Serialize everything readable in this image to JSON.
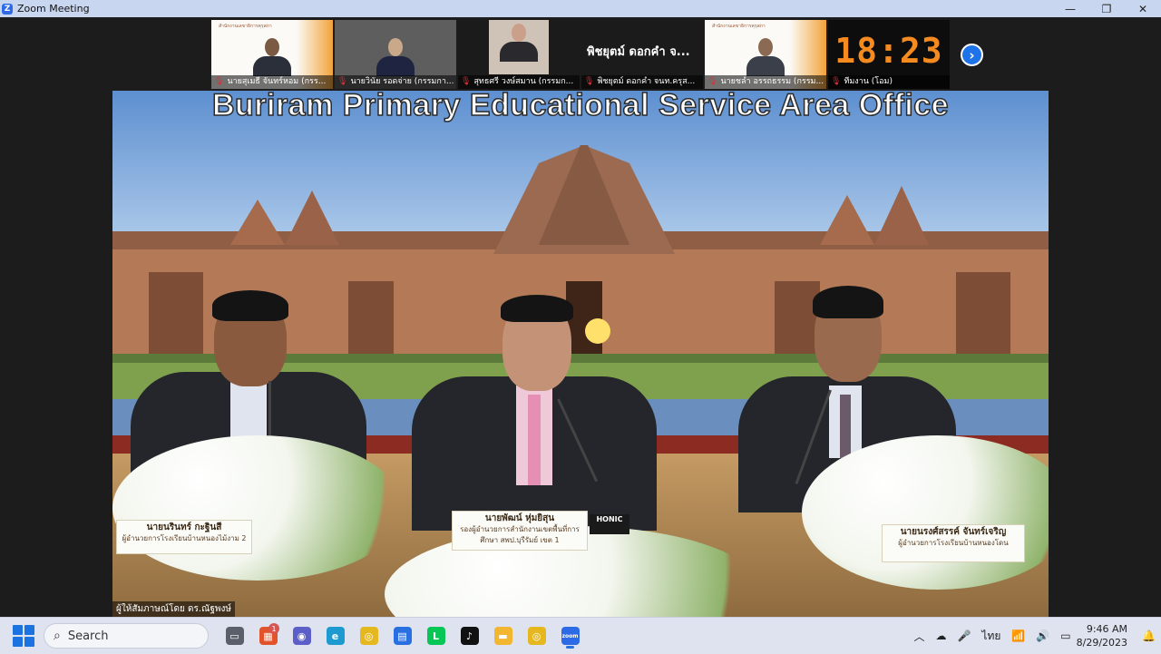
{
  "window": {
    "title": "Zoom Meeting",
    "controls": [
      "—",
      "❐",
      "✕"
    ]
  },
  "participants": [
    {
      "label": "นายสุเมธี จันทร์หอม (กรร...",
      "type": "video-logo",
      "logo_text": "สำนักงานเลขาธิการคุรุสภา"
    },
    {
      "label": "นายวินัย รอดจ่าย (กรรมกา...",
      "type": "video-gray"
    },
    {
      "label": "สุทธศรี วงษ์สมาน (กรรมก...",
      "type": "video-dark"
    },
    {
      "label": "พิชยุตม์ ดอกคำ จนท.ครุส...",
      "type": "name-only",
      "display_name": "พิชยุตม์ ดอกคำ จ..."
    },
    {
      "label": "นายชลำ อรรถธรรม (กรรม...",
      "type": "video-logo",
      "logo_text": "สำนักงานเลขาธิการคุรุสภา"
    },
    {
      "label": "ทีมงาน (โอม)",
      "type": "clock",
      "clock_text": "18:23"
    }
  ],
  "next_button": "›",
  "main_video": {
    "banner": "Buriram Primary Educational Service Area Office",
    "nameplates": [
      {
        "name": "นายนรินทร์ กะฐินสี",
        "role": "ผู้อำนวยการโรงเรียนบ้านหนองไม้งาม 2"
      },
      {
        "name": "นายพัฒน์ หุ่มยิสุน",
        "role": "รองผู้อำนวยการสำนักงานเขตพื้นที่การศึกษา สพป.บุรีรัมย์ เขต 1"
      },
      {
        "name": "นายนรงศ์สรรค์ จันทร์เจริญ",
        "role": "ผู้อำนวยการโรงเรียนบ้านหนองโดน"
      }
    ],
    "mic_brand": "HONIC",
    "caption": "ผู้ให้สัมภาษณ์โดย ดร.ณัฐพงษ์"
  },
  "taskbar": {
    "search_label": "Search",
    "apps": [
      {
        "name": "task-view",
        "color": "#5b5f6b",
        "text": "▭"
      },
      {
        "name": "microsoft-365",
        "color": "#e0532b",
        "text": "▦",
        "badge": "1"
      },
      {
        "name": "teams-meet",
        "color": "#5b5fc7",
        "text": "◉"
      },
      {
        "name": "edge",
        "color": "#1d9bd1",
        "text": "e"
      },
      {
        "name": "chrome",
        "color": "#e5b820",
        "text": "◎"
      },
      {
        "name": "store",
        "color": "#2a6fe0",
        "text": "▤"
      },
      {
        "name": "line",
        "color": "#06c755",
        "text": "L"
      },
      {
        "name": "tiktok",
        "color": "#111111",
        "text": "♪"
      },
      {
        "name": "file-explorer",
        "color": "#f2b630",
        "text": "▬"
      },
      {
        "name": "chrome-profile",
        "color": "#e5b820",
        "text": "◎"
      },
      {
        "name": "zoom",
        "color": "#2d6be6",
        "text": "zoom",
        "active": true
      }
    ],
    "tray": {
      "chevron": "︿",
      "cloud": "☁",
      "mic": "🎤",
      "lang": "ไทย",
      "wifi": "📶",
      "volume": "🔊",
      "battery": "▭",
      "time": "9:46 AM",
      "date": "8/29/2023",
      "notifications": "🔔"
    }
  }
}
